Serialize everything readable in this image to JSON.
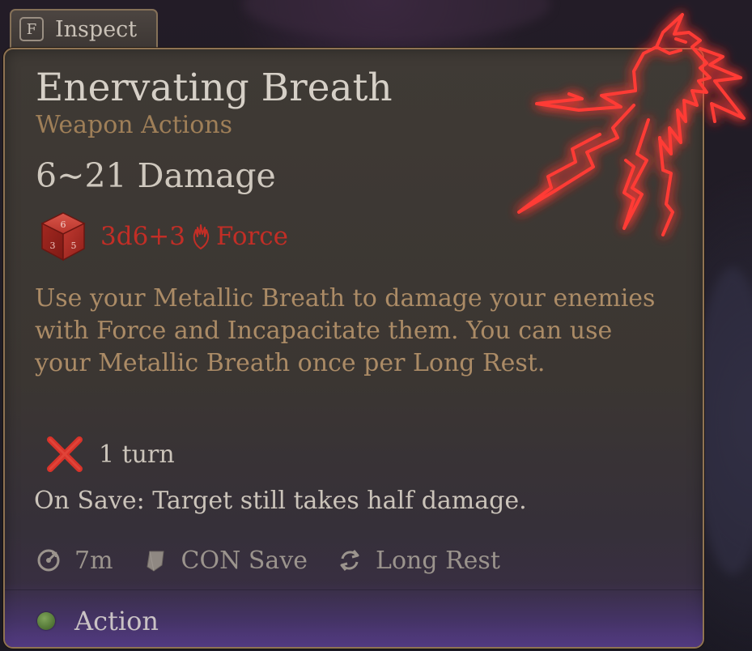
{
  "inspect": {
    "key": "F",
    "label": "Inspect"
  },
  "tooltip": {
    "title": "Enervating Breath",
    "subtitle": "Weapon Actions",
    "damage_range": "6~21 Damage",
    "dice_formula": "3d6+3",
    "damage_type": "Force",
    "description": "Use your Metallic Breath to damage your enemies with Force and Incapacitate them. You can use your Metallic Breath once per Long Rest.",
    "condition": {
      "icon": "incapacitated-x-icon",
      "text": "1 turn"
    },
    "save_note": "On Save: Target still takes half damage.",
    "stats": [
      {
        "icon": "range-icon",
        "text": "7m"
      },
      {
        "icon": "saving-throw-icon",
        "text": "CON Save"
      },
      {
        "icon": "recharge-icon",
        "text": "Long Rest"
      }
    ],
    "cost": {
      "icon": "action-dot-icon",
      "label": "Action"
    },
    "emblem": "dragon-breath-icon"
  },
  "colors": {
    "panel_border": "#8f7352",
    "title": "#d6d0c7",
    "subtitle": "#9f7f58",
    "damage_red": "#c22e26",
    "description": "#ab8b66",
    "stat_grey": "#9b948d",
    "action_green": "#5c8a3a",
    "emblem_glow": "#ff2a2a"
  }
}
